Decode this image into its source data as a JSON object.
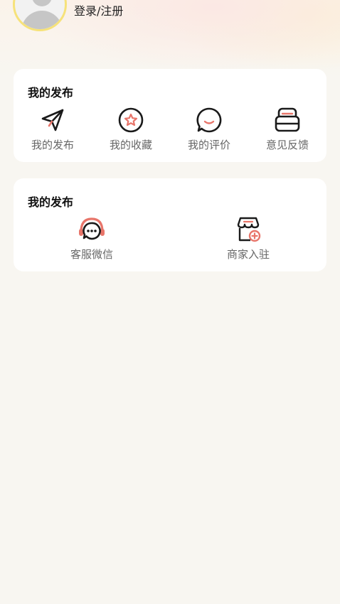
{
  "profile": {
    "login_label": "登录/注册"
  },
  "section1": {
    "title": "我的发布",
    "items": [
      {
        "label": "我的发布",
        "icon": "paper-plane-icon"
      },
      {
        "label": "我的收藏",
        "icon": "star-circle-icon"
      },
      {
        "label": "我的评价",
        "icon": "comment-smile-icon"
      },
      {
        "label": "意见反馈",
        "icon": "feedback-box-icon"
      }
    ]
  },
  "section2": {
    "title": "我的发布",
    "items": [
      {
        "label": "客服微信",
        "icon": "headset-chat-icon"
      },
      {
        "label": "商家入驻",
        "icon": "store-add-icon"
      }
    ]
  },
  "colors": {
    "accent": "#e8756a",
    "avatar_ring": "#f6e27a",
    "background": "#f8f6f1"
  }
}
